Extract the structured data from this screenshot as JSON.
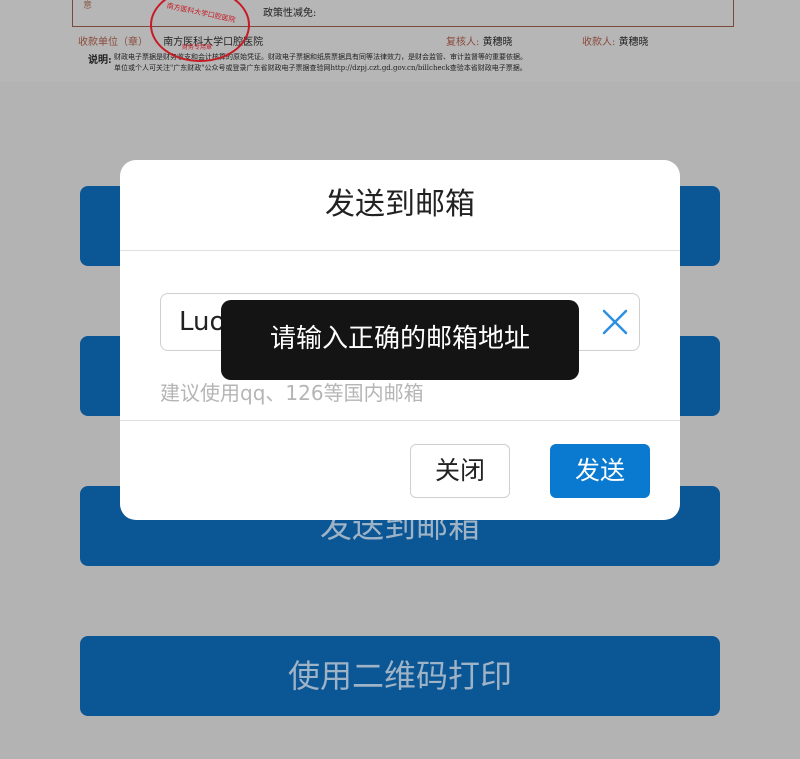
{
  "receipt": {
    "tick_text": "意",
    "policy_label": "政策性减免:",
    "payee_label": "收款单位（章）",
    "payee_value": "南方医科大学口腔医院",
    "reviewer_label": "复核人:",
    "reviewer_value": "黄穗晓",
    "collector_label": "收款人:",
    "collector_value": "黄穗晓",
    "notes_label": "说明:",
    "notes_line1": "财政电子票据是财务收支和会计核算的原始凭证。财政电子票据和纸质票据具有同等法律效力，是财会监管、审计监督等的重要依据。",
    "notes_line2": "单位或个人可关注\"广东财政\"公众号或登录广东省财政电子票据查验网http://dzpj.czt.gd.gov.cn/billcheck查验本省财政电子票据。",
    "stamp_text": "南方医科大学口腔医院",
    "stamp_sub": "财务专用章"
  },
  "background_buttons": {
    "send_email_label": "发送到邮箱",
    "qr_print_label": "使用二维码打印"
  },
  "modal": {
    "title": "发送到邮箱",
    "email_value": "Luo",
    "hint": "建议使用qq、126等国内邮箱",
    "close_label": "关闭",
    "send_label": "发送"
  },
  "toast": {
    "message": "请输入正确的邮箱地址"
  },
  "colors": {
    "primary": "#0a7ad0",
    "bg_button": "#0b5694",
    "overlay": "#b3b3b3",
    "toast": "#141414"
  },
  "icons": {
    "clear": "close-icon"
  }
}
